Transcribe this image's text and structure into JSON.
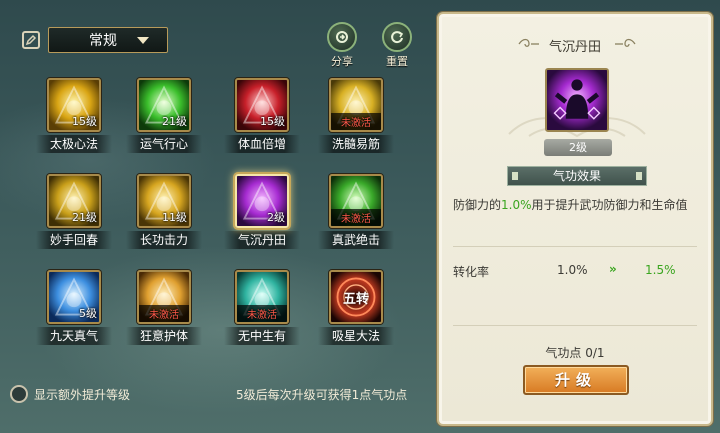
{
  "toolbar": {
    "mode_value": "常规",
    "share_label": "分享",
    "reset_label": "重置"
  },
  "skills": [
    {
      "name": "太极心法",
      "level": "15级",
      "locked": false
    },
    {
      "name": "运气行心",
      "level": "21级",
      "locked": false
    },
    {
      "name": "体血倍增",
      "level": "15级",
      "locked": false
    },
    {
      "name": "洗髓易筋",
      "level": "未激活",
      "locked": true
    },
    {
      "name": "妙手回春",
      "level": "21级",
      "locked": false
    },
    {
      "name": "长功击力",
      "level": "11级",
      "locked": false
    },
    {
      "name": "气沉丹田",
      "level": "2级",
      "locked": false,
      "selected": true
    },
    {
      "name": "真武绝击",
      "level": "未激活",
      "locked": true
    },
    {
      "name": "九天真气",
      "level": "5级",
      "locked": false
    },
    {
      "name": "狂意护体",
      "level": "未激活",
      "locked": true
    },
    {
      "name": "无中生有",
      "level": "未激活",
      "locked": true
    },
    {
      "name": "吸星大法",
      "level": "",
      "locked": false,
      "badge": "五转"
    }
  ],
  "footer": {
    "toggle_label": "显示额外提升等级",
    "hint": "5级后每次升级可获得1点气功点"
  },
  "detail": {
    "title": "气沉丹田",
    "level": "2级",
    "effect_header": "气功效果",
    "desc_prefix": "防御力的",
    "desc_highlight": "1.0%",
    "desc_suffix": "用于提升武功防御力和生命值",
    "rate_label": "转化率",
    "rate_current": "1.0%",
    "rate_arrow": "»",
    "rate_next": "1.5%",
    "points": "气功点 0/1",
    "upgrade_label": "升级"
  },
  "colors": {
    "highlight_green": "#3aa51f",
    "locked_red": "#ff5a4a",
    "button_orange": "#d87a23"
  }
}
